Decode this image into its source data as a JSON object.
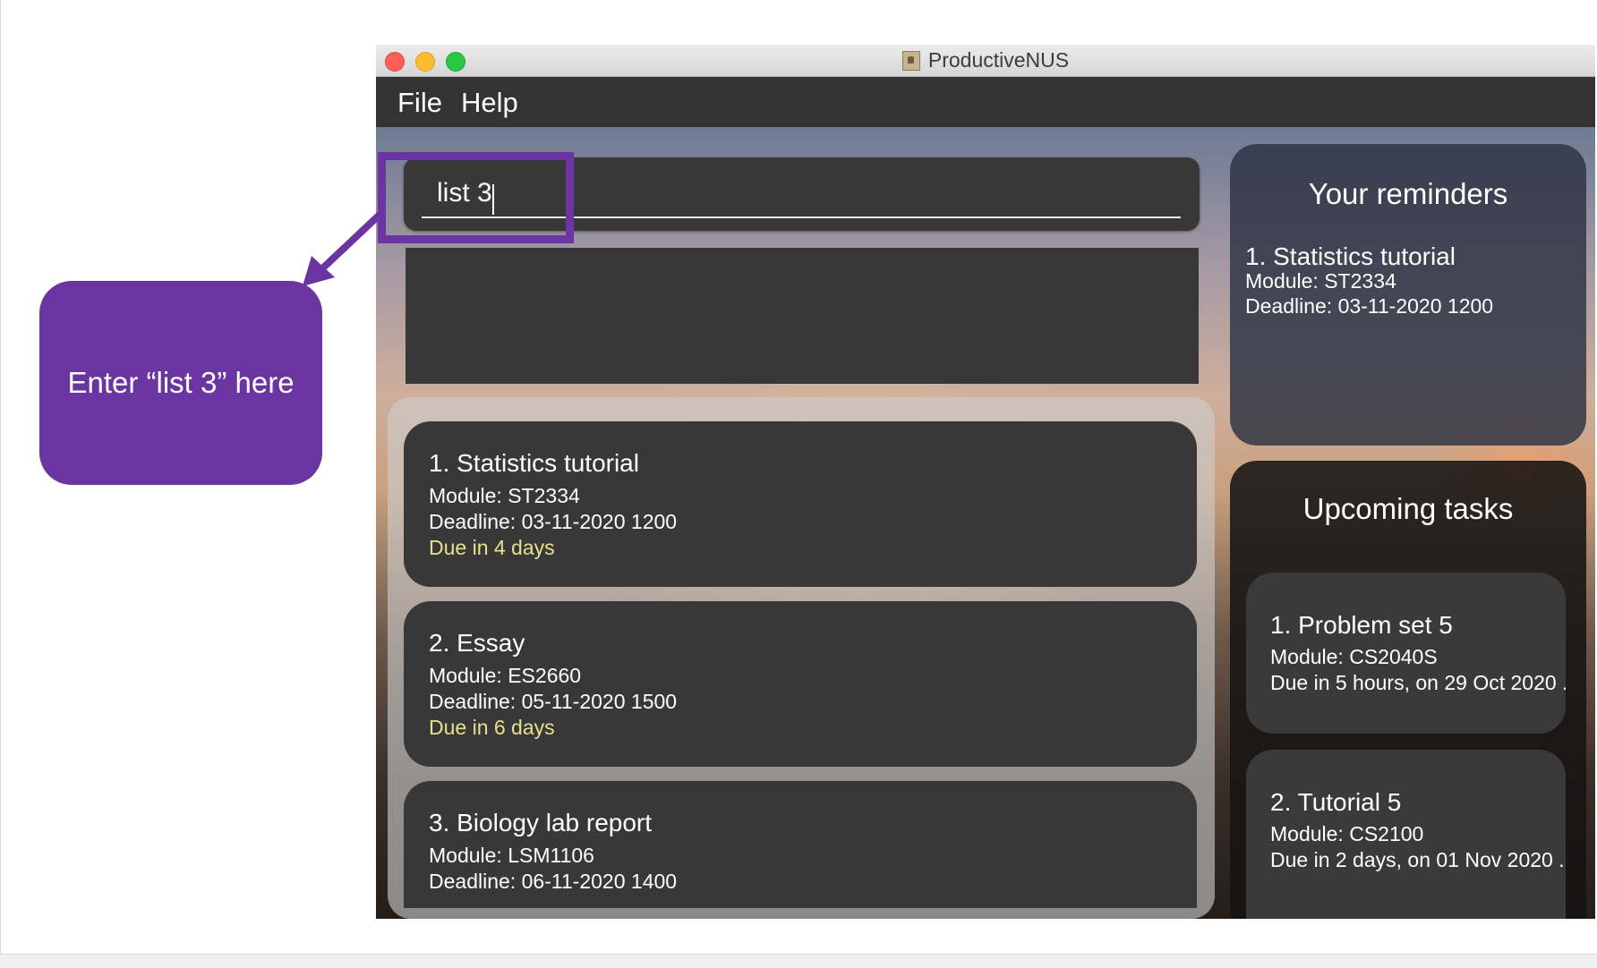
{
  "window": {
    "title": "ProductiveNUS"
  },
  "menu": [
    {
      "label": "File"
    },
    {
      "label": "Help"
    }
  ],
  "command": {
    "value": "list 3"
  },
  "tasks": [
    {
      "title": "1.  Statistics tutorial",
      "module": "Module: ST2334",
      "deadline": "Deadline: 03-11-2020 1200",
      "due": "Due in 4 days"
    },
    {
      "title": "2.  Essay",
      "module": "Module: ES2660",
      "deadline": "Deadline: 05-11-2020 1500",
      "due": "Due in 6 days"
    },
    {
      "title": "3.  Biology lab report",
      "module": "Module: LSM1106",
      "deadline": "Deadline: 06-11-2020 1400",
      "due": ""
    }
  ],
  "reminders": {
    "heading": "Your reminders",
    "items": [
      {
        "title": "1.  Statistics tutorial",
        "module": "Module: ST2334",
        "deadline": "Deadline: 03-11-2020 1200"
      }
    ]
  },
  "upcoming": {
    "heading": "Upcoming tasks",
    "items": [
      {
        "title": "1.  Problem set 5",
        "module": "Module: CS2040S",
        "due": "Due in 5 hours, on 29 Oct 2020 ...",
        "due_color": "#ff6a4f"
      },
      {
        "title": "2.  Tutorial 5",
        "module": "Module: CS2100",
        "due": "Due in 2 days, on 01 Nov 2020 ...",
        "due_color": "#e7e08c"
      }
    ]
  },
  "annotation": {
    "text": "Enter “list 3” here",
    "color": "#6a35a0"
  }
}
